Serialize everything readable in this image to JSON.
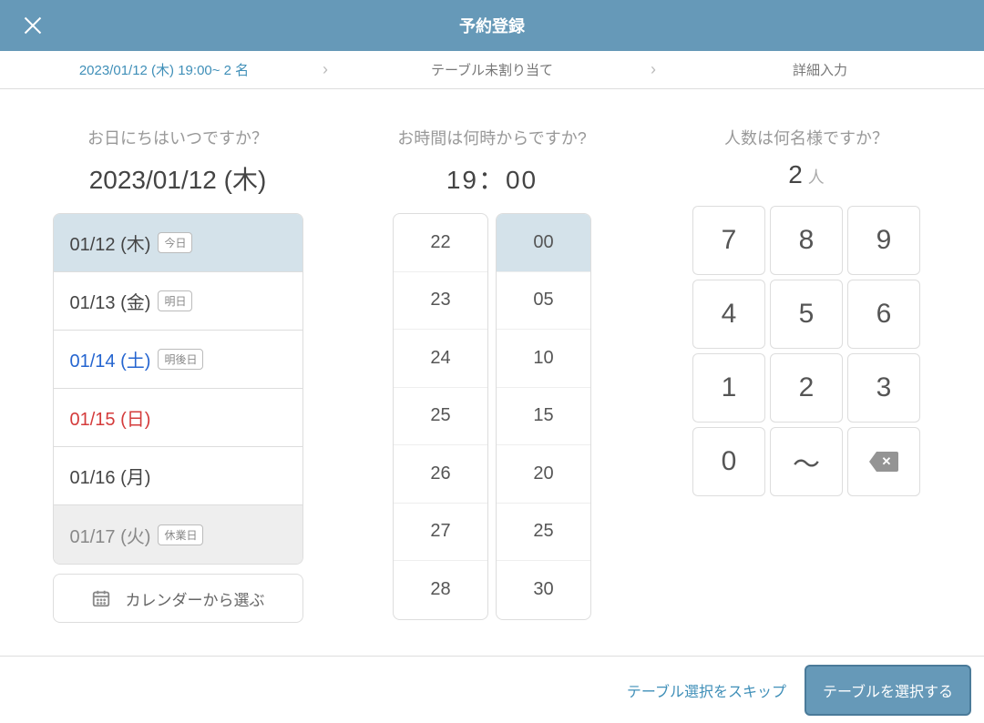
{
  "header": {
    "title": "予約登録"
  },
  "breadcrumb": {
    "step1": "2023/01/12 (木) 19:00~ 2 名",
    "step2": "テーブル未割り当て",
    "step3": "詳細入力"
  },
  "date": {
    "question": "お日にちはいつですか？",
    "value": "2023/01/12 (木)",
    "items": [
      {
        "label": "01/12 (木)",
        "badge": "今日",
        "cls": "selected"
      },
      {
        "label": "01/13 (金)",
        "badge": "明日",
        "cls": ""
      },
      {
        "label": "01/14 (土)",
        "badge": "明後日",
        "cls": "saturday"
      },
      {
        "label": "01/15 (日)",
        "badge": "",
        "cls": "sunday"
      },
      {
        "label": "01/16 (月)",
        "badge": "",
        "cls": ""
      },
      {
        "label": "01/17 (火)",
        "badge": "休業日",
        "cls": "closed"
      }
    ],
    "calendar_button": "カレンダーから選ぶ"
  },
  "time": {
    "question": "お時間は何時からですか?",
    "value": "19：00",
    "hours": [
      "22",
      "23",
      "24",
      "25",
      "26",
      "27",
      "28"
    ],
    "minutes": [
      "00",
      "05",
      "10",
      "15",
      "20",
      "25",
      "30"
    ],
    "selected_minute": "00"
  },
  "people": {
    "question": "人数は何名様ですか？",
    "value": "2",
    "unit": "人",
    "keys": [
      "7",
      "8",
      "9",
      "4",
      "5",
      "6",
      "1",
      "2",
      "3",
      "0",
      "〜"
    ]
  },
  "footer": {
    "skip": "テーブル選択をスキップ",
    "select": "テーブルを選択する"
  }
}
